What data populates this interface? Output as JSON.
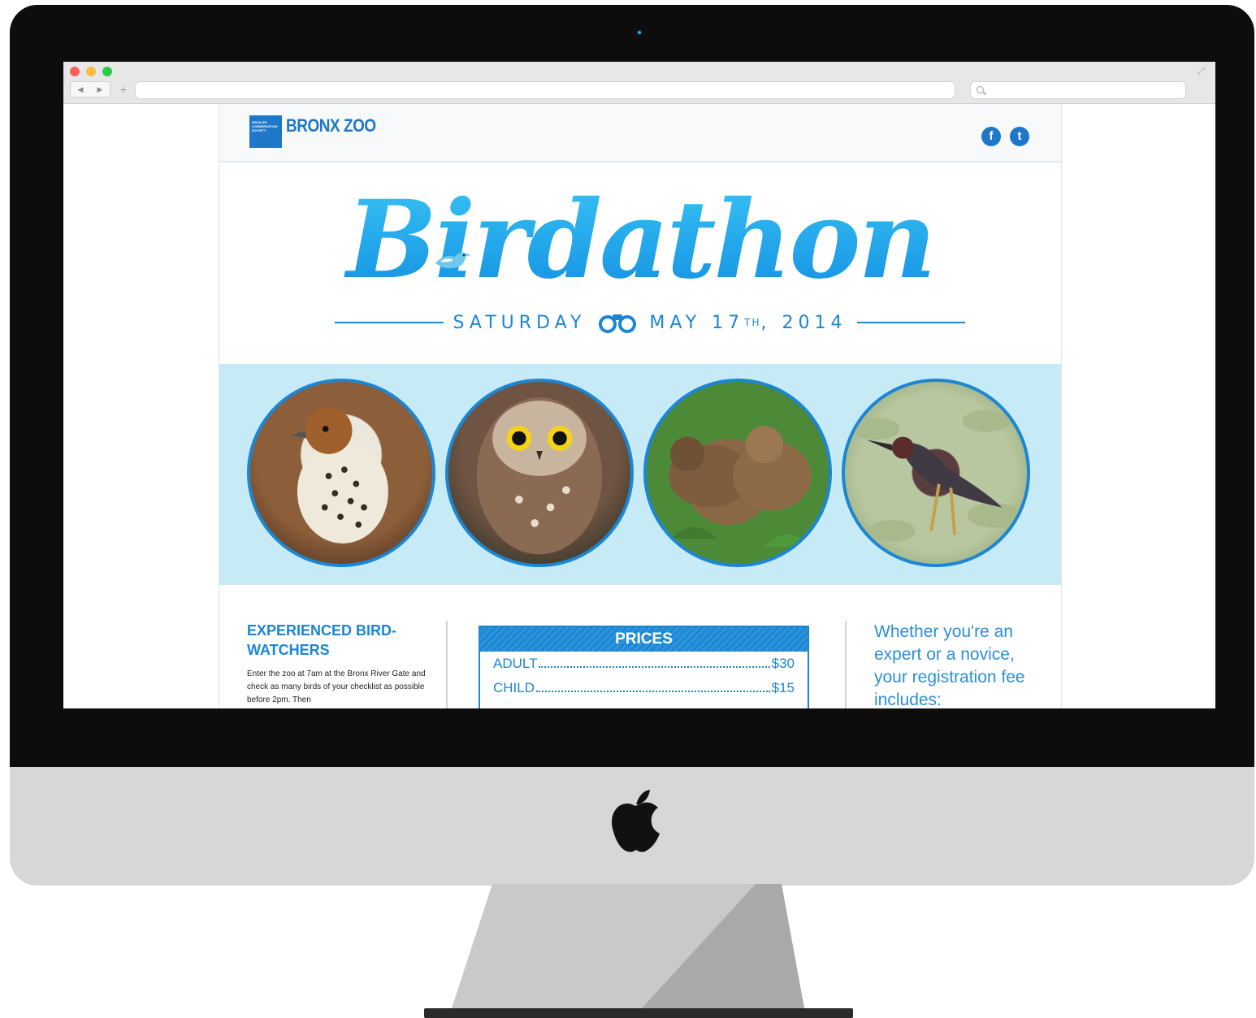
{
  "browser": {
    "back_label": "◀",
    "forward_label": "▶",
    "new_tab_label": "+",
    "url": "",
    "search_placeholder": ""
  },
  "site": {
    "logo_small_text": "WILDLIFE CONSERVATION SOCIETY",
    "logo_text": "BRONX ZOO",
    "facebook_label": "f",
    "twitter_label": "t"
  },
  "hero": {
    "title": "Birdathon",
    "date_day": "SATURDAY",
    "date_month_day": "MAY 17",
    "date_suffix": "TH",
    "date_year": ", 2014"
  },
  "photos": [
    {
      "alt": "wood thrush"
    },
    {
      "alt": "saw-whet owl"
    },
    {
      "alt": "ducklings"
    },
    {
      "alt": "green heron"
    }
  ],
  "experienced": {
    "heading": "EXPERIENCED BIRD-WATCHERS",
    "body": "Enter the zoo at 7am at the Bronx River Gate and check as many birds of your checklist as possible before 2pm. Then"
  },
  "prices": {
    "heading": "PRICES",
    "rows": [
      {
        "label": "ADULT",
        "value": "$30"
      },
      {
        "label": "CHILD",
        "value": "$15"
      }
    ]
  },
  "registration": {
    "text": "Whether you're an expert or a novice, your registration fee includes:"
  },
  "colors": {
    "brand_blue": "#1c86d3",
    "band_blue": "#c6ebf7"
  }
}
